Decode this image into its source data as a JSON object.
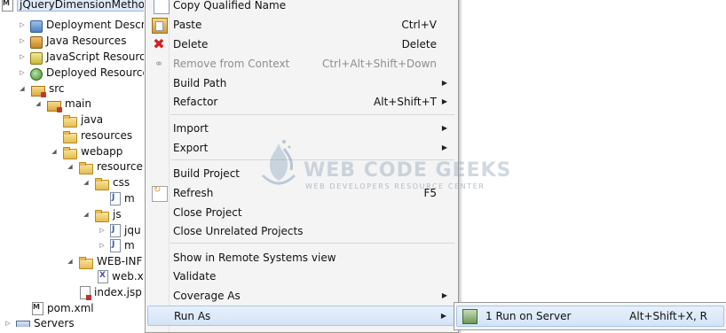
{
  "tree": {
    "items": [
      {
        "label": "jQueryDimensionMetho",
        "icon": "maven-project-icon"
      },
      {
        "label": "Deployment Descrip",
        "icon": "deployment-descriptor-icon"
      },
      {
        "label": "Java Resources",
        "icon": "java-resources-icon"
      },
      {
        "label": "JavaScript Resources",
        "icon": "javascript-resources-icon"
      },
      {
        "label": "Deployed Resources",
        "icon": "deployed-resources-icon"
      },
      {
        "label": "src",
        "icon": "package-folder-icon"
      },
      {
        "label": "main",
        "icon": "package-folder-icon"
      },
      {
        "label": "java",
        "icon": "folder-icon"
      },
      {
        "label": "resources",
        "icon": "folder-icon"
      },
      {
        "label": "webapp",
        "icon": "folder-icon"
      },
      {
        "label": "resource",
        "icon": "folder-icon"
      },
      {
        "label": "css",
        "icon": "folder-icon"
      },
      {
        "label": "m",
        "icon": "file-icon"
      },
      {
        "label": "js",
        "icon": "folder-icon"
      },
      {
        "label": "jqu",
        "icon": "js-file-icon"
      },
      {
        "label": "m",
        "icon": "js-file-icon"
      },
      {
        "label": "WEB-INF",
        "icon": "folder-icon"
      },
      {
        "label": "web.x",
        "icon": "xml-file-icon"
      },
      {
        "label": "index.jsp",
        "icon": "jsp-file-icon"
      },
      {
        "label": "pom.xml",
        "icon": "maven-file-icon"
      },
      {
        "label": "Servers",
        "icon": "servers-folder-icon"
      }
    ]
  },
  "menu": {
    "items": [
      {
        "label": "Copy Qualified Name",
        "shortcut": "",
        "icon": "copy-icon"
      },
      {
        "label": "Paste",
        "shortcut": "Ctrl+V",
        "icon": "paste-icon"
      },
      {
        "label": "Delete",
        "shortcut": "Delete",
        "icon": "delete-icon"
      },
      {
        "label": "Remove from Context",
        "shortcut": "Ctrl+Alt+Shift+Down",
        "icon": "remove-context-icon"
      },
      {
        "label": "Build Path",
        "shortcut": "",
        "icon": ""
      },
      {
        "label": "Refactor",
        "shortcut": "Alt+Shift+T",
        "icon": ""
      },
      {
        "label": "Import",
        "shortcut": "",
        "icon": ""
      },
      {
        "label": "Export",
        "shortcut": "",
        "icon": ""
      },
      {
        "label": "Build Project",
        "shortcut": "",
        "icon": ""
      },
      {
        "label": "Refresh",
        "shortcut": "F5",
        "icon": "refresh-icon"
      },
      {
        "label": "Close Project",
        "shortcut": "",
        "icon": ""
      },
      {
        "label": "Close Unrelated Projects",
        "shortcut": "",
        "icon": ""
      },
      {
        "label": "Show in Remote Systems view",
        "shortcut": "",
        "icon": ""
      },
      {
        "label": "Validate",
        "shortcut": "",
        "icon": ""
      },
      {
        "label": "Coverage As",
        "shortcut": "",
        "icon": ""
      },
      {
        "label": "Run As",
        "shortcut": "",
        "icon": ""
      }
    ]
  },
  "submenu": {
    "item_label": "1 Run on Server",
    "item_shortcut": "Alt+Shift+X, R"
  },
  "watermark": {
    "title": "WEB CODE GEEKS",
    "subtitle": "WEB DEVELOPERS RESOURCE CENTER"
  }
}
